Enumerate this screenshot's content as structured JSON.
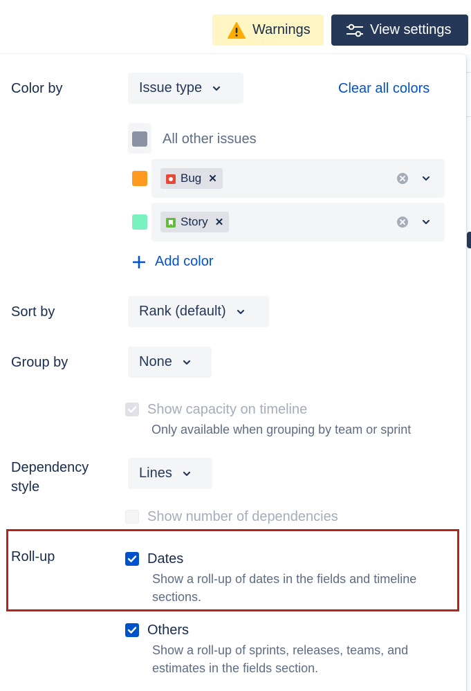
{
  "toolbar": {
    "warnings_label": "Warnings",
    "view_settings_label": "View settings",
    "warning_icon": "warning-triangle-icon",
    "settings_icon": "sliders-icon",
    "warn_bg": "#fff6c4",
    "view_bg": "#253858"
  },
  "color_by": {
    "label": "Color by",
    "selected": "Issue type",
    "clear_link": "Clear all colors",
    "other_label": "All other issues",
    "rules": [
      {
        "color": "#ff991f",
        "tag": "Bug",
        "tag_icon": "bug-icon"
      },
      {
        "color": "#79f2c0",
        "tag": "Story",
        "tag_icon": "story-icon"
      }
    ],
    "other_color": "#8993a4",
    "add_label": "Add color"
  },
  "sort_by": {
    "label": "Sort by",
    "selected": "Rank (default)"
  },
  "group_by": {
    "label": "Group by",
    "selected": "None",
    "capacity_label": "Show capacity on timeline",
    "capacity_help": "Only available when grouping by team or sprint"
  },
  "dependency": {
    "label_line1": "Dependency",
    "label_line2": "style",
    "selected": "Lines",
    "show_number_label": "Show number of dependencies"
  },
  "rollup": {
    "label": "Roll-up",
    "dates_label": "Dates",
    "dates_help_1": "Show a roll-up of dates in the fields and timeline",
    "dates_help_2": "sections.",
    "others_label": "Others",
    "others_help_1": "Show a roll-up of sprints, releases, teams, and",
    "others_help_2": "estimates in the fields section."
  },
  "colors": {
    "primary": "#0052cc",
    "highlight": "#b3261e"
  }
}
